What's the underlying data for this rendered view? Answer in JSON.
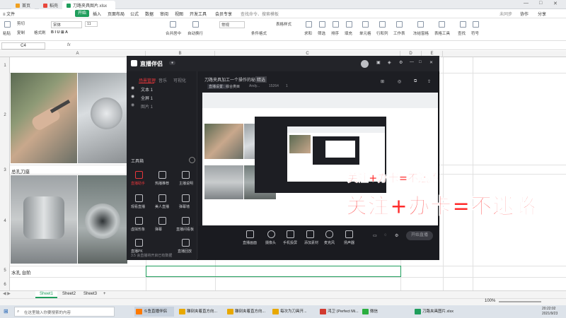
{
  "titlebar": {
    "tabs": [
      "首页",
      "稻壳",
      "刀路夹具图片.xlsx"
    ],
    "controls": [
      "—",
      "□",
      "✕"
    ]
  },
  "menubar": {
    "items": [
      "≡ 文件",
      "开始",
      "插入",
      "页面布局",
      "公式",
      "数据",
      "审阅",
      "视图",
      "开发工具",
      "会员专享"
    ],
    "search": "查找命令、搜索模板",
    "right": [
      "未同步",
      "协作",
      "分享"
    ]
  },
  "ribbon": {
    "items": [
      "粘贴",
      "剪切",
      "复制",
      "格式刷",
      "宋体",
      "11",
      "合并居中",
      "自动换行",
      "常规",
      "条件格式",
      "表格样式",
      "求和",
      "筛选",
      "排序",
      "填充",
      "单元格",
      "行和列",
      "工作表",
      "冻结窗格",
      "表格工具",
      "查找",
      "符号"
    ]
  },
  "formula": {
    "cell": "C4",
    "fx": "fx"
  },
  "sheet": {
    "columns": [
      "A",
      "B",
      "C",
      "D",
      "E"
    ],
    "rows": [
      "1",
      "2",
      "3",
      "4",
      "5",
      "6"
    ],
    "labels": {
      "row3": "总孔刀座",
      "row5": "水孔 台阶"
    }
  },
  "app": {
    "title": "直播伴侣",
    "tabs": [
      "场景管理",
      "音乐",
      "可视化"
    ],
    "layers": [
      "文本 1",
      "全屏 1",
      "图片 1"
    ],
    "toolbox": "工具箱",
    "tools": [
      "直播助手",
      "热播推荐",
      "主播说明",
      "观看直播",
      "美人直播",
      "弹幕墙",
      "虚拟形象",
      "弹幕",
      "直播间看板",
      "直播PK",
      "直播回放"
    ],
    "footer_hint": "3.5 会直播将开启已有数据",
    "headline": "刀路夹具加工一个操作的秘诀",
    "headline_badge": "精选",
    "subline": [
      "直播设置：",
      "综合类目",
      "Andy...",
      "15264",
      "1"
    ],
    "bottom": [
      "直播画面",
      "摄像头",
      "手机投屏",
      "添加素材",
      "麦克风",
      "扬声器"
    ],
    "start": "开始直播",
    "banner_big": "关注+办卡=不迷路",
    "banner_small": "关注+办卡=不迷路"
  },
  "sheettabs": [
    "Sheet1",
    "Sheet2",
    "Sheet3",
    "+"
  ],
  "status": {
    "zoom": "100%",
    "time": "20:22:02",
    "date": "2021/9/23"
  },
  "taskbar": {
    "search": "在这里输入你要搜索的内容",
    "apps": [
      "斗鱼直播伴侣",
      "雕刻夹着直方向...",
      "雕刻夹着直方向...",
      "每次为刀具开...",
      "鸿卫 (Perfect Mi...",
      "微信",
      "刀路夹具图片.xlsx"
    ]
  },
  "colors": {
    "accent": "#1f9e5c",
    "banner": "#ff2b2b",
    "app_bg": "#1d1e23"
  }
}
